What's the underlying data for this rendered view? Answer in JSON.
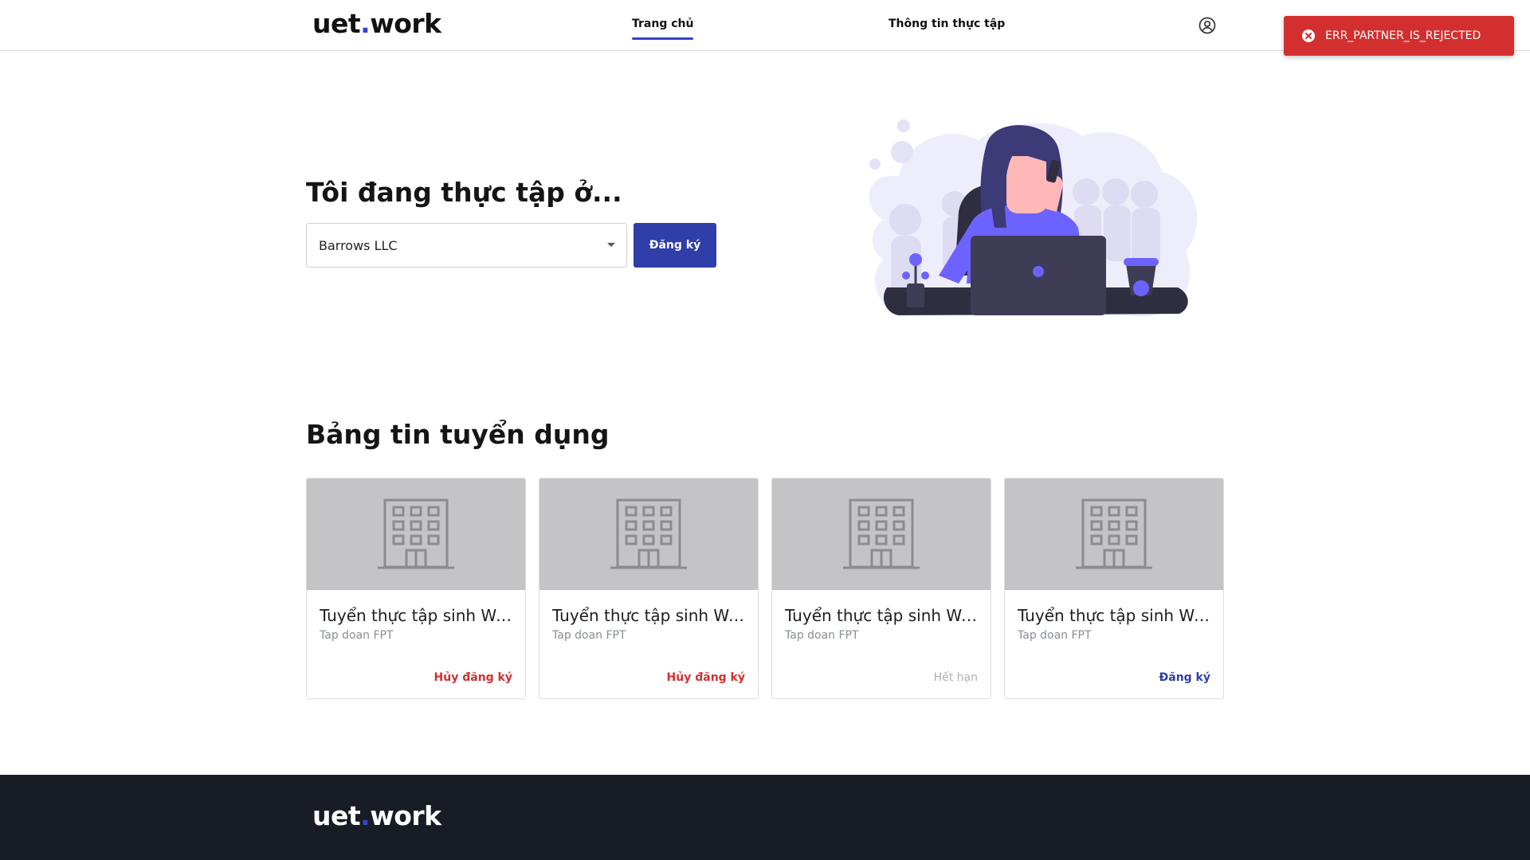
{
  "header": {
    "logo_main": "uet",
    "logo_dot": ".",
    "logo_tail": "work",
    "nav": [
      {
        "label": "Trang chủ",
        "active": true
      },
      {
        "label": "Thông tin thực tập",
        "active": false
      }
    ],
    "user_icon": "user-circle-icon"
  },
  "toast": {
    "message": "ERR_PARTNER_IS_REJECTED",
    "icon": "error-circle-icon",
    "color": "#d32f2f"
  },
  "hero": {
    "title": "Tôi đang thực tập ở...",
    "select_value": "Barrows LLC",
    "register_label": "Đăng ký"
  },
  "jobs": {
    "title": "Bảng tin tuyển dụng",
    "cards": [
      {
        "title": "Tuyển thực tập sinh Web Developer",
        "company": "Tap doan FPT",
        "action": "Hủy đăng ký",
        "status": "cancel"
      },
      {
        "title": "Tuyển thực tập sinh Web Developer",
        "company": "Tap doan FPT",
        "action": "Hủy đăng ký",
        "status": "cancel"
      },
      {
        "title": "Tuyển thực tập sinh Web Developer",
        "company": "Tap doan FPT",
        "action": "Hết hạn",
        "status": "expired"
      },
      {
        "title": "Tuyển thực tập sinh Web Developer",
        "company": "Tap doan FPT",
        "action": "Đăng ký",
        "status": "register"
      }
    ]
  },
  "footer": {
    "logo_main": "uet",
    "logo_dot": ".",
    "logo_tail": "work"
  },
  "colors": {
    "primary": "#2f3ea8",
    "danger": "#d32f2f",
    "footer_bg": "#171c25",
    "placeholder_bg": "#c4c4c6"
  }
}
